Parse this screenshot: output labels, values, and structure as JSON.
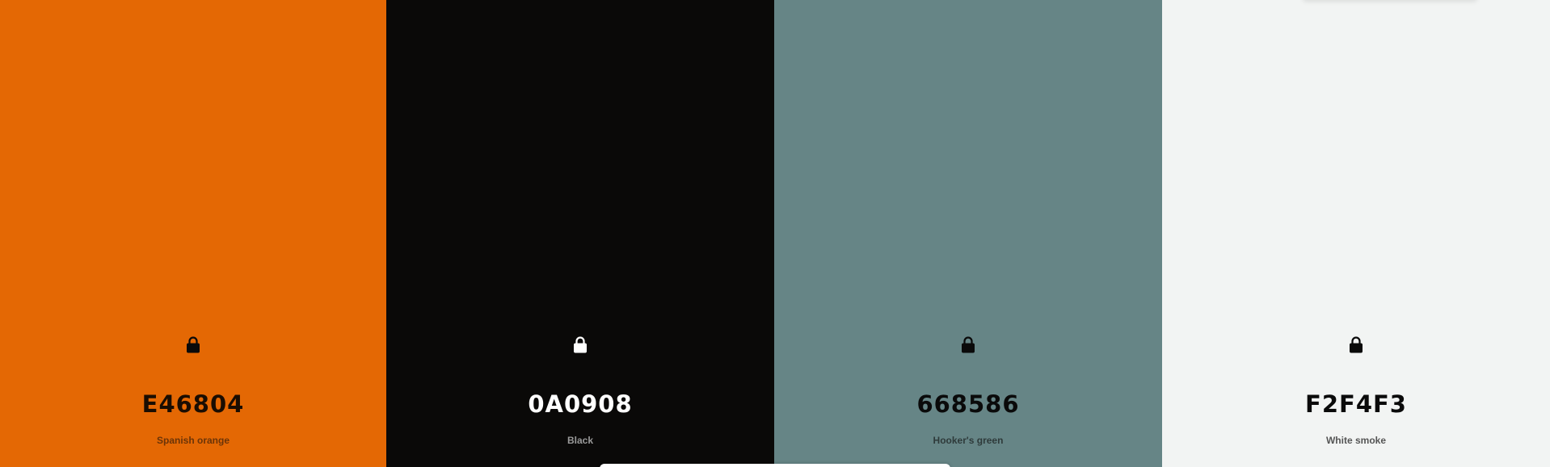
{
  "palette": {
    "colors": [
      {
        "hex": "E46804",
        "name": "Spanish orange",
        "value": "#E46804",
        "lock_icon": "lock-icon",
        "locked": true
      },
      {
        "hex": "0A0908",
        "name": "Black",
        "value": "#0A0908",
        "lock_icon": "lock-icon",
        "locked": true
      },
      {
        "hex": "668586",
        "name": "Hooker's green",
        "value": "#668586",
        "lock_icon": "lock-icon",
        "locked": true
      },
      {
        "hex": "F2F4F3",
        "name": "White smoke",
        "value": "#F2F4F3",
        "lock_icon": "lock-icon",
        "locked": true
      }
    ]
  },
  "theme": {
    "lock_dark": "#0a0a0a",
    "lock_light": "#ffffff"
  }
}
